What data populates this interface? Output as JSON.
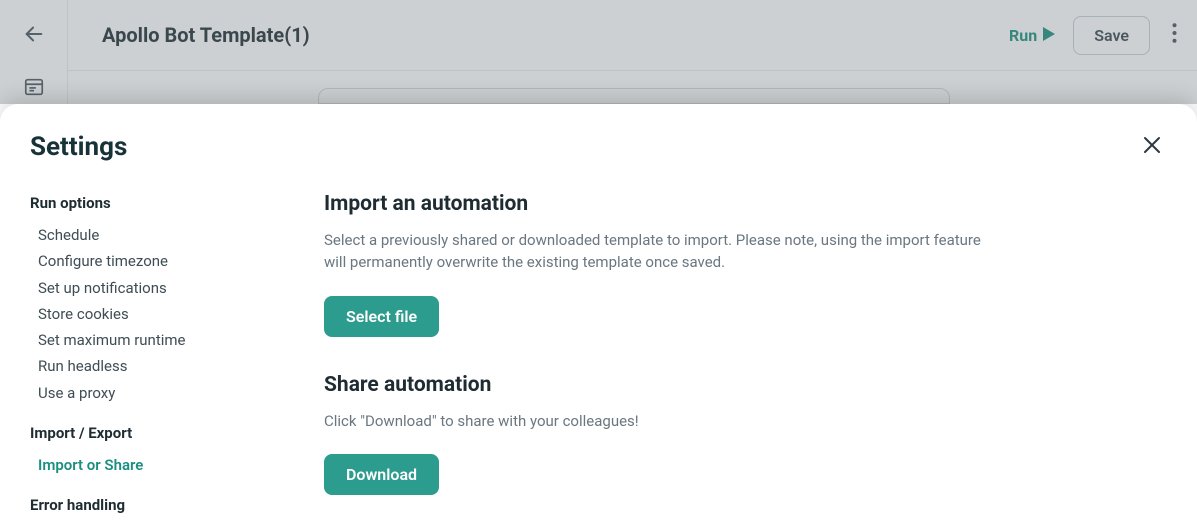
{
  "topbar": {
    "title": "Apollo Bot Template(1)",
    "run_label": "Run",
    "save_label": "Save"
  },
  "modal": {
    "title": "Settings"
  },
  "sidebar": {
    "sections": [
      {
        "title": "Run options",
        "items": [
          {
            "label": "Schedule",
            "active": false
          },
          {
            "label": "Configure timezone",
            "active": false
          },
          {
            "label": "Set up notifications",
            "active": false
          },
          {
            "label": "Store cookies",
            "active": false
          },
          {
            "label": "Set maximum runtime",
            "active": false
          },
          {
            "label": "Run headless",
            "active": false
          },
          {
            "label": "Use a proxy",
            "active": false
          }
        ]
      },
      {
        "title": "Import / Export",
        "items": [
          {
            "label": "Import or Share",
            "active": true
          }
        ]
      },
      {
        "title": "Error handling",
        "items": []
      }
    ]
  },
  "content": {
    "import_heading": "Import an automation",
    "import_text": "Select a previously shared or downloaded template to import. Please note, using the import feature will permanently overwrite the existing template once saved.",
    "select_file_label": "Select file",
    "share_heading": "Share automation",
    "share_text": "Click \"Download\" to share with your colleagues!",
    "download_label": "Download"
  }
}
